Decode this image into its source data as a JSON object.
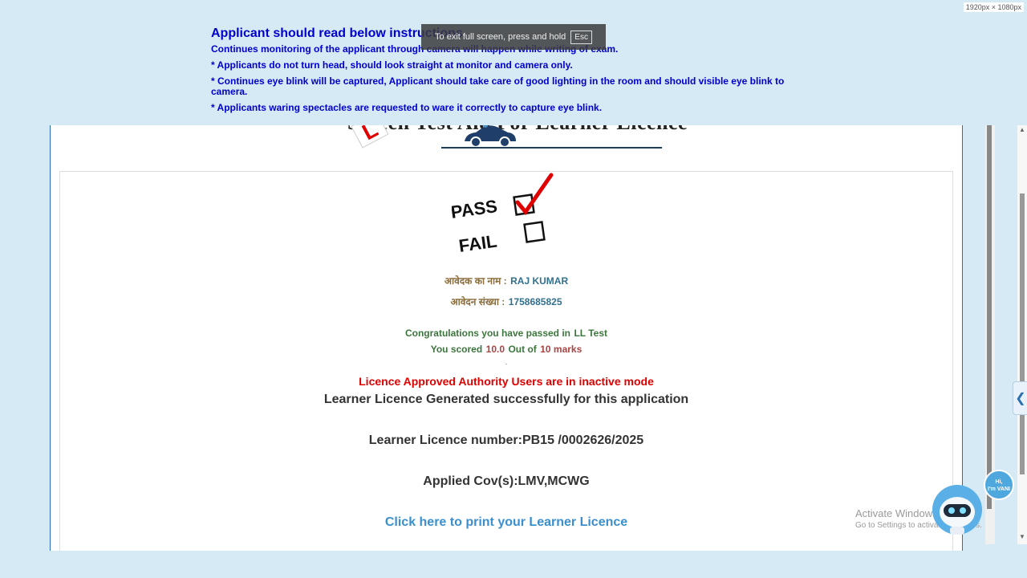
{
  "screen_size_label": "1920px × 1080px",
  "fullscreen_toast": {
    "text": "To exit full screen, press and hold",
    "key": "Esc"
  },
  "instructions": {
    "title": "Applicant should read below instructions",
    "lines": [
      "Continues monitoring of the applicant through camera will happen while writing of exam.",
      "* Applicants do not turn head, should look straight at monitor and camera only.",
      "* Continues eye blink will be captured, Applicant should take care of good lighting in the room and should visible eye blink to camera.",
      "* Applicants waring spectacles are requested to ware it correctly to capture eye blink."
    ]
  },
  "banner": {
    "title": "Screen Test Aid For Learner Licence",
    "l_plate": "L"
  },
  "result": {
    "pass_label": "PASS",
    "fail_label": "FAIL",
    "applicant_name_label": "आवेदक का नाम :",
    "applicant_name": "RAJ KUMAR",
    "application_number_label": "आवेदन संख्या :",
    "application_number": "1758685825",
    "congrats_prefix": "Congratulations you have passed in",
    "congrats_test": "LL Test",
    "score_prefix": "You scored",
    "score": "10.0",
    "score_mid": "Out of",
    "score_total": "10 marks",
    "dot": ".",
    "inactive_notice": "Licence Approved Authority Users are in inactive mode",
    "generated_msg": "Learner Licence Generated successfully for this application",
    "licence_number_text": "Learner Licence number:PB15 /0002626/2025",
    "cov_text": "Applied Cov(s):LMV,MCWG",
    "print_link": "Click here to print your Learner Licence"
  },
  "watermark": {
    "line1": "Activate Windows",
    "line2": "Go to Settings to activate Windows."
  },
  "chatbot": {
    "bubble_line1": "Hi,",
    "bubble_line2": "I'm VANI"
  },
  "icons": {
    "sidetab": "chevron-left-icon",
    "scroll_up": "triangle-up-icon",
    "scroll_down": "triangle-down-icon"
  }
}
